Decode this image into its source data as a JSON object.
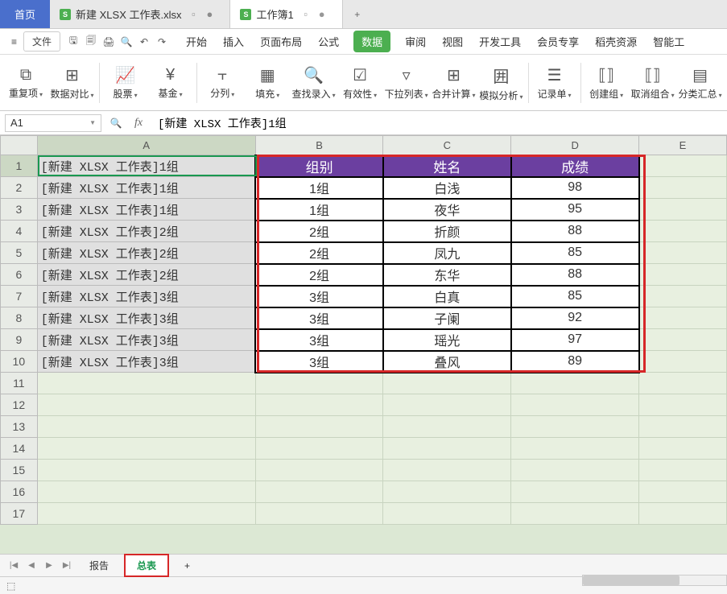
{
  "topbar": {
    "home": "首页",
    "tab1": "新建 XLSX 工作表.xlsx",
    "tab2": "工作簿1",
    "newtab": "+"
  },
  "menubar": {
    "file": "文件"
  },
  "ribbon_tabs": [
    "开始",
    "插入",
    "页面布局",
    "公式",
    "数据",
    "审阅",
    "视图",
    "开发工具",
    "会员专享",
    "稻壳资源",
    "智能工"
  ],
  "ribbon_active": "数据",
  "ribbon_groups": [
    "重复项",
    "数据对比",
    "股票",
    "基金",
    "分列",
    "填充",
    "查找录入",
    "有效性",
    "下拉列表",
    "合并计算",
    "模拟分析",
    "记录单",
    "创建组",
    "取消组合",
    "分类汇总"
  ],
  "formulabar": {
    "name": "A1",
    "formula": "[新建 XLSX 工作表]1组"
  },
  "columns": [
    "A",
    "B",
    "C",
    "D",
    "E"
  ],
  "rows": [
    {
      "n": 1,
      "a": "[新建 XLSX 工作表]1组",
      "b": "组别",
      "c": "姓名",
      "d": "成绩",
      "hdr": true
    },
    {
      "n": 2,
      "a": "[新建 XLSX 工作表]1组",
      "b": "1组",
      "c": "白浅",
      "d": "98"
    },
    {
      "n": 3,
      "a": "[新建 XLSX 工作表]1组",
      "b": "1组",
      "c": "夜华",
      "d": "95"
    },
    {
      "n": 4,
      "a": "[新建 XLSX 工作表]2组",
      "b": "2组",
      "c": "折颜",
      "d": "88"
    },
    {
      "n": 5,
      "a": "[新建 XLSX 工作表]2组",
      "b": "2组",
      "c": "凤九",
      "d": "85"
    },
    {
      "n": 6,
      "a": "[新建 XLSX 工作表]2组",
      "b": "2组",
      "c": "东华",
      "d": "88"
    },
    {
      "n": 7,
      "a": "[新建 XLSX 工作表]3组",
      "b": "3组",
      "c": "白真",
      "d": "85"
    },
    {
      "n": 8,
      "a": "[新建 XLSX 工作表]3组",
      "b": "3组",
      "c": "子阑",
      "d": "92"
    },
    {
      "n": 9,
      "a": "[新建 XLSX 工作表]3组",
      "b": "3组",
      "c": "瑶光",
      "d": "97"
    },
    {
      "n": 10,
      "a": "[新建 XLSX 工作表]3组",
      "b": "3组",
      "c": "叠风",
      "d": "89"
    }
  ],
  "empty_rows": [
    11,
    12,
    13,
    14,
    15,
    16,
    17
  ],
  "sheets": {
    "s1": "报告",
    "s2": "总表",
    "add": "+"
  },
  "chart_data": {
    "type": "table",
    "columns": [
      "组别",
      "姓名",
      "成绩"
    ],
    "rows": [
      [
        "1组",
        "白浅",
        98
      ],
      [
        "1组",
        "夜华",
        95
      ],
      [
        "2组",
        "折颜",
        88
      ],
      [
        "2组",
        "凤九",
        85
      ],
      [
        "2组",
        "东华",
        88
      ],
      [
        "3组",
        "白真",
        85
      ],
      [
        "3组",
        "子阑",
        92
      ],
      [
        "3组",
        "瑶光",
        97
      ],
      [
        "3组",
        "叠风",
        89
      ]
    ]
  }
}
